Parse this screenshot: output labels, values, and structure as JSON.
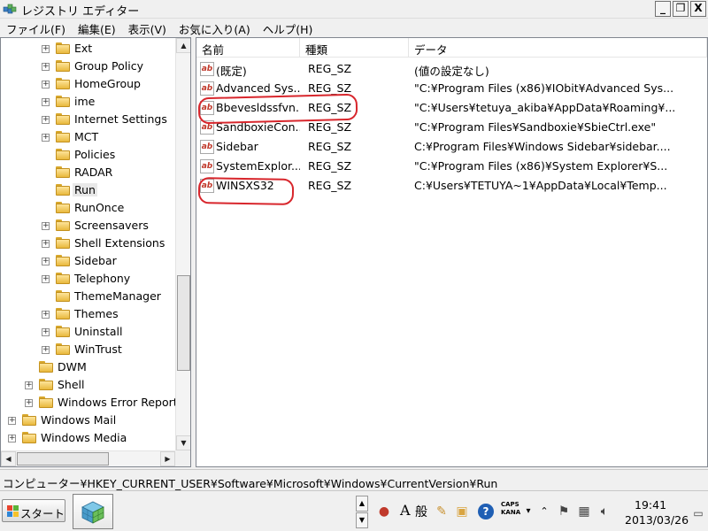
{
  "window": {
    "title": "レジストリ エディター",
    "min_label": "_",
    "max_label": "❐",
    "close_label": "X"
  },
  "menu": [
    "ファイル(F)",
    "編集(E)",
    "表示(V)",
    "お気に入り(A)",
    "ヘルプ(H)"
  ],
  "tree": {
    "items": [
      {
        "label": "Ext",
        "expandable": true,
        "level": 3
      },
      {
        "label": "Group Policy",
        "expandable": true,
        "level": 3
      },
      {
        "label": "HomeGroup",
        "expandable": true,
        "level": 3
      },
      {
        "label": "ime",
        "expandable": true,
        "level": 3
      },
      {
        "label": "Internet Settings",
        "expandable": true,
        "level": 3
      },
      {
        "label": "MCT",
        "expandable": true,
        "level": 3
      },
      {
        "label": "Policies",
        "expandable": false,
        "level": 3
      },
      {
        "label": "RADAR",
        "expandable": false,
        "level": 3
      },
      {
        "label": "Run",
        "expandable": false,
        "level": 3,
        "selected": true
      },
      {
        "label": "RunOnce",
        "expandable": false,
        "level": 3
      },
      {
        "label": "Screensavers",
        "expandable": true,
        "level": 3
      },
      {
        "label": "Shell Extensions",
        "expandable": true,
        "level": 3
      },
      {
        "label": "Sidebar",
        "expandable": true,
        "level": 3
      },
      {
        "label": "Telephony",
        "expandable": true,
        "level": 3
      },
      {
        "label": "ThemeManager",
        "expandable": false,
        "level": 3
      },
      {
        "label": "Themes",
        "expandable": true,
        "level": 3
      },
      {
        "label": "Uninstall",
        "expandable": true,
        "level": 3
      },
      {
        "label": "WinTrust",
        "expandable": true,
        "level": 3
      },
      {
        "label": "DWM",
        "expandable": false,
        "level": 2
      },
      {
        "label": "Shell",
        "expandable": true,
        "level": 2
      },
      {
        "label": "Windows Error Reportin",
        "expandable": true,
        "level": 2
      },
      {
        "label": "Windows Mail",
        "expandable": true,
        "level": 1
      },
      {
        "label": "Windows Media",
        "expandable": true,
        "level": 1
      }
    ]
  },
  "list": {
    "headers": {
      "name": "名前",
      "type": "種類",
      "data": "データ"
    },
    "rows": [
      {
        "name": "(既定)",
        "type": "REG_SZ",
        "data": "(値の設定なし)"
      },
      {
        "name": "Advanced Sys...",
        "type": "REG_SZ",
        "data": "\"C:¥Program Files (x86)¥IObit¥Advanced Sys..."
      },
      {
        "name": "Bbevesldssfvn...",
        "type": "REG_SZ",
        "data": "\"C:¥Users¥tetuya_akiba¥AppData¥Roaming¥..."
      },
      {
        "name": "SandboxieCon...",
        "type": "REG_SZ",
        "data": "\"C:¥Program Files¥Sandboxie¥SbieCtrl.exe\""
      },
      {
        "name": "Sidebar",
        "type": "REG_SZ",
        "data": "C:¥Program Files¥Windows Sidebar¥sidebar...."
      },
      {
        "name": "SystemExplor...",
        "type": "REG_SZ",
        "data": "\"C:¥Program Files (x86)¥System Explorer¥S..."
      },
      {
        "name": "WINSXS32",
        "type": "REG_SZ",
        "data": "C:¥Users¥TETUYA~1¥AppData¥Local¥Temp..."
      }
    ]
  },
  "status": {
    "path": "コンピューター¥HKEY_CURRENT_USER¥Software¥Microsoft¥Windows¥CurrentVersion¥Run"
  },
  "taskbar": {
    "start_label": "スタート",
    "ime_mode": "A",
    "ime_kanji": "般",
    "caps_label": "CAPS",
    "kana_label": "KANA",
    "time": "19:41",
    "date": "2013/03/26"
  },
  "colors": {
    "annotation": "#d8262c",
    "value_icon": "#c0392b",
    "folder": "#e9b93d"
  }
}
